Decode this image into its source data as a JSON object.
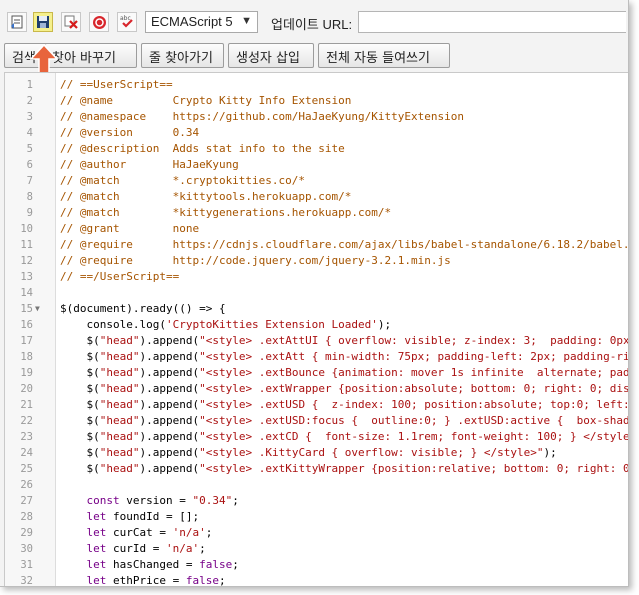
{
  "toolbar": {
    "language_select": "ECMAScript 5",
    "update_url_label": "업데이트 URL:",
    "update_url_value": "",
    "icons": [
      "page-icon",
      "save-icon",
      "close-icon",
      "stop-icon",
      "spellcheck-icon"
    ],
    "spellcheck_text": "abc",
    "buttons": {
      "search": "검색",
      "find_replace": "찾아 바꾸기",
      "goto_line": "줄 찾아가기",
      "insert_constructor": "생성자 삽입",
      "auto_indent": "전체 자동 들여쓰기"
    },
    "highlight_arrow_color": "#e8643c"
  },
  "editor": {
    "lines": [
      {
        "n": "1",
        "text": "// ==UserScript==",
        "cls": "cm"
      },
      {
        "n": "2",
        "text": "// @name         Crypto Kitty Info Extension",
        "cls": "cm"
      },
      {
        "n": "3",
        "text": "// @namespace    https://github.com/HaJaeKyung/KittyExtension",
        "cls": "cm"
      },
      {
        "n": "4",
        "text": "// @version      0.34",
        "cls": "cm"
      },
      {
        "n": "5",
        "text": "// @description  Adds stat info to the site",
        "cls": "cm"
      },
      {
        "n": "6",
        "text": "// @author       HaJaeKyung",
        "cls": "cm"
      },
      {
        "n": "7",
        "text": "// @match        *.cryptokitties.co/*",
        "cls": "cm"
      },
      {
        "n": "8",
        "text": "// @match        *kittytools.herokuapp.com/*",
        "cls": "cm"
      },
      {
        "n": "9",
        "text": "// @match        *kittygenerations.herokuapp.com/*",
        "cls": "cm"
      },
      {
        "n": "10",
        "text": "// @grant        none",
        "cls": "cm"
      },
      {
        "n": "11",
        "text": "// @require      https://cdnjs.cloudflare.com/ajax/libs/babel-standalone/6.18.2/babel.js",
        "cls": "cm"
      },
      {
        "n": "12",
        "text": "// @require      http://code.jquery.com/jquery-3.2.1.min.js",
        "cls": "cm"
      },
      {
        "n": "13",
        "text": "// ==/UserScript==",
        "cls": "cm"
      },
      {
        "n": "14",
        "text": "",
        "cls": ""
      },
      {
        "n": "15",
        "text": "$(document).ready(() => {",
        "cls": "",
        "fold": true
      },
      {
        "n": "16",
        "text": "    console.log('CryptoKitties Extension Loaded');",
        "cls": ""
      },
      {
        "n": "17",
        "text": "    $(\"head\").append(\"<style> .extAttUI { overflow: visible; z-index: 3;  padding: 0px; mar",
        "cls": ""
      },
      {
        "n": "18",
        "text": "    $(\"head\").append(\"<style> .extAtt { min-width: 75px; padding-left: 2px; padding-right:",
        "cls": ""
      },
      {
        "n": "19",
        "text": "    $(\"head\").append(\"<style> .extBounce {animation: mover 1s infinite  alternate; padding-",
        "cls": ""
      },
      {
        "n": "20",
        "text": "    $(\"head\").append(\"<style> .extWrapper {position:absolute; bottom: 0; right: 0; display:",
        "cls": ""
      },
      {
        "n": "21",
        "text": "    $(\"head\").append(\"<style> .extUSD {  z-index: 100; position:absolute; top:0; left:0; bo",
        "cls": ""
      },
      {
        "n": "22",
        "text": "    $(\"head\").append(\"<style> .extUSD:focus {  outline:0; } .extUSD:active {  box-shadow: 0",
        "cls": ""
      },
      {
        "n": "23",
        "text": "    $(\"head\").append(\"<style> .extCD {  font-size: 1.1rem; font-weight: 100; } </style>\");",
        "cls": ""
      },
      {
        "n": "24",
        "text": "    $(\"head\").append(\"<style> .KittyCard { overflow: visible; } </style>\");",
        "cls": ""
      },
      {
        "n": "25",
        "text": "    $(\"head\").append(\"<style> .extKittyWrapper {position:relative; bottom: 0; right: 0; dis",
        "cls": ""
      },
      {
        "n": "26",
        "text": "",
        "cls": ""
      },
      {
        "n": "27",
        "text": "    const version = \"0.34\";",
        "cls": ""
      },
      {
        "n": "28",
        "text": "    let foundId = [];",
        "cls": ""
      },
      {
        "n": "29",
        "text": "    let curCat = 'n/a';",
        "cls": ""
      },
      {
        "n": "30",
        "text": "    let curId = 'n/a';",
        "cls": ""
      },
      {
        "n": "31",
        "text": "    let hasChanged = false;",
        "cls": ""
      },
      {
        "n": "32",
        "text": "    let ethPrice = false;",
        "cls": ""
      }
    ]
  }
}
